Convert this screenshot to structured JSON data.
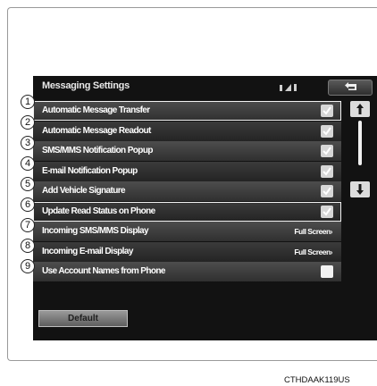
{
  "screen": {
    "title": "Messaging Settings",
    "back_icon": "back-arrow-icon",
    "items": [
      {
        "number": "1",
        "label": "Automatic Message Transfer",
        "control": "checkbox",
        "checked": true
      },
      {
        "number": "2",
        "label": "Automatic Message Readout",
        "control": "checkbox",
        "checked": true
      },
      {
        "number": "3",
        "label": "SMS/MMS Notification Popup",
        "control": "checkbox",
        "checked": true
      },
      {
        "number": "4",
        "label": "E-mail Notification Popup",
        "control": "checkbox",
        "checked": true
      },
      {
        "number": "5",
        "label": "Add Vehicle Signature",
        "control": "checkbox",
        "checked": true
      },
      {
        "number": "6",
        "label": "Update Read Status on Phone",
        "control": "checkbox",
        "checked": true
      },
      {
        "number": "7",
        "label": "Incoming SMS/MMS Display",
        "control": "value",
        "value": "Full Screen"
      },
      {
        "number": "8",
        "label": "Incoming E-mail Display",
        "control": "value",
        "value": "Full Screen"
      },
      {
        "number": "9",
        "label": "Use Account Names from Phone",
        "control": "checkbox",
        "checked": false
      }
    ],
    "default_button": "Default"
  },
  "figure_code": "CTHDAAK119US"
}
